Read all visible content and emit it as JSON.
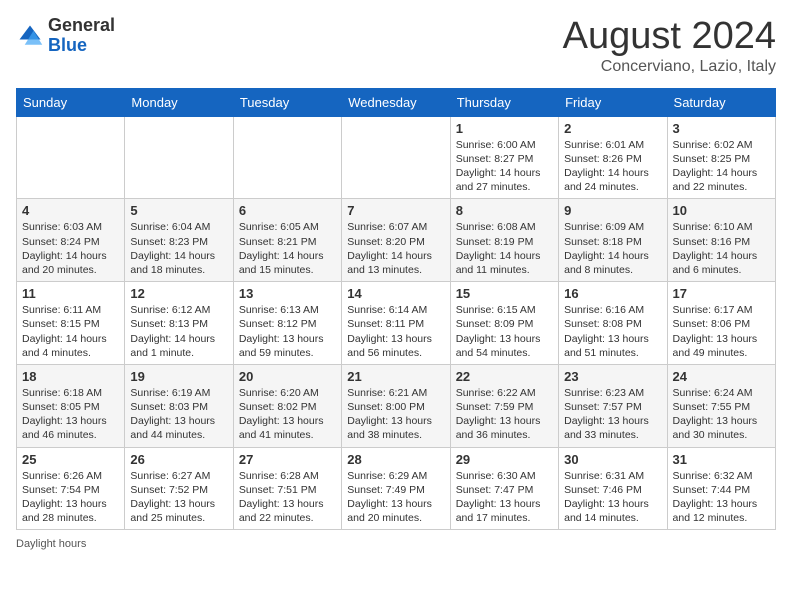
{
  "header": {
    "logo_general": "General",
    "logo_blue": "Blue",
    "month_title": "August 2024",
    "location": "Concerviano, Lazio, Italy"
  },
  "days_of_week": [
    "Sunday",
    "Monday",
    "Tuesday",
    "Wednesday",
    "Thursday",
    "Friday",
    "Saturday"
  ],
  "weeks": [
    [
      {
        "day": "",
        "info": ""
      },
      {
        "day": "",
        "info": ""
      },
      {
        "day": "",
        "info": ""
      },
      {
        "day": "",
        "info": ""
      },
      {
        "day": "1",
        "info": "Sunrise: 6:00 AM\nSunset: 8:27 PM\nDaylight: 14 hours and 27 minutes."
      },
      {
        "day": "2",
        "info": "Sunrise: 6:01 AM\nSunset: 8:26 PM\nDaylight: 14 hours and 24 minutes."
      },
      {
        "day": "3",
        "info": "Sunrise: 6:02 AM\nSunset: 8:25 PM\nDaylight: 14 hours and 22 minutes."
      }
    ],
    [
      {
        "day": "4",
        "info": "Sunrise: 6:03 AM\nSunset: 8:24 PM\nDaylight: 14 hours and 20 minutes."
      },
      {
        "day": "5",
        "info": "Sunrise: 6:04 AM\nSunset: 8:23 PM\nDaylight: 14 hours and 18 minutes."
      },
      {
        "day": "6",
        "info": "Sunrise: 6:05 AM\nSunset: 8:21 PM\nDaylight: 14 hours and 15 minutes."
      },
      {
        "day": "7",
        "info": "Sunrise: 6:07 AM\nSunset: 8:20 PM\nDaylight: 14 hours and 13 minutes."
      },
      {
        "day": "8",
        "info": "Sunrise: 6:08 AM\nSunset: 8:19 PM\nDaylight: 14 hours and 11 minutes."
      },
      {
        "day": "9",
        "info": "Sunrise: 6:09 AM\nSunset: 8:18 PM\nDaylight: 14 hours and 8 minutes."
      },
      {
        "day": "10",
        "info": "Sunrise: 6:10 AM\nSunset: 8:16 PM\nDaylight: 14 hours and 6 minutes."
      }
    ],
    [
      {
        "day": "11",
        "info": "Sunrise: 6:11 AM\nSunset: 8:15 PM\nDaylight: 14 hours and 4 minutes."
      },
      {
        "day": "12",
        "info": "Sunrise: 6:12 AM\nSunset: 8:13 PM\nDaylight: 14 hours and 1 minute."
      },
      {
        "day": "13",
        "info": "Sunrise: 6:13 AM\nSunset: 8:12 PM\nDaylight: 13 hours and 59 minutes."
      },
      {
        "day": "14",
        "info": "Sunrise: 6:14 AM\nSunset: 8:11 PM\nDaylight: 13 hours and 56 minutes."
      },
      {
        "day": "15",
        "info": "Sunrise: 6:15 AM\nSunset: 8:09 PM\nDaylight: 13 hours and 54 minutes."
      },
      {
        "day": "16",
        "info": "Sunrise: 6:16 AM\nSunset: 8:08 PM\nDaylight: 13 hours and 51 minutes."
      },
      {
        "day": "17",
        "info": "Sunrise: 6:17 AM\nSunset: 8:06 PM\nDaylight: 13 hours and 49 minutes."
      }
    ],
    [
      {
        "day": "18",
        "info": "Sunrise: 6:18 AM\nSunset: 8:05 PM\nDaylight: 13 hours and 46 minutes."
      },
      {
        "day": "19",
        "info": "Sunrise: 6:19 AM\nSunset: 8:03 PM\nDaylight: 13 hours and 44 minutes."
      },
      {
        "day": "20",
        "info": "Sunrise: 6:20 AM\nSunset: 8:02 PM\nDaylight: 13 hours and 41 minutes."
      },
      {
        "day": "21",
        "info": "Sunrise: 6:21 AM\nSunset: 8:00 PM\nDaylight: 13 hours and 38 minutes."
      },
      {
        "day": "22",
        "info": "Sunrise: 6:22 AM\nSunset: 7:59 PM\nDaylight: 13 hours and 36 minutes."
      },
      {
        "day": "23",
        "info": "Sunrise: 6:23 AM\nSunset: 7:57 PM\nDaylight: 13 hours and 33 minutes."
      },
      {
        "day": "24",
        "info": "Sunrise: 6:24 AM\nSunset: 7:55 PM\nDaylight: 13 hours and 30 minutes."
      }
    ],
    [
      {
        "day": "25",
        "info": "Sunrise: 6:26 AM\nSunset: 7:54 PM\nDaylight: 13 hours and 28 minutes."
      },
      {
        "day": "26",
        "info": "Sunrise: 6:27 AM\nSunset: 7:52 PM\nDaylight: 13 hours and 25 minutes."
      },
      {
        "day": "27",
        "info": "Sunrise: 6:28 AM\nSunset: 7:51 PM\nDaylight: 13 hours and 22 minutes."
      },
      {
        "day": "28",
        "info": "Sunrise: 6:29 AM\nSunset: 7:49 PM\nDaylight: 13 hours and 20 minutes."
      },
      {
        "day": "29",
        "info": "Sunrise: 6:30 AM\nSunset: 7:47 PM\nDaylight: 13 hours and 17 minutes."
      },
      {
        "day": "30",
        "info": "Sunrise: 6:31 AM\nSunset: 7:46 PM\nDaylight: 13 hours and 14 minutes."
      },
      {
        "day": "31",
        "info": "Sunrise: 6:32 AM\nSunset: 7:44 PM\nDaylight: 13 hours and 12 minutes."
      }
    ]
  ],
  "footer": "Daylight hours"
}
